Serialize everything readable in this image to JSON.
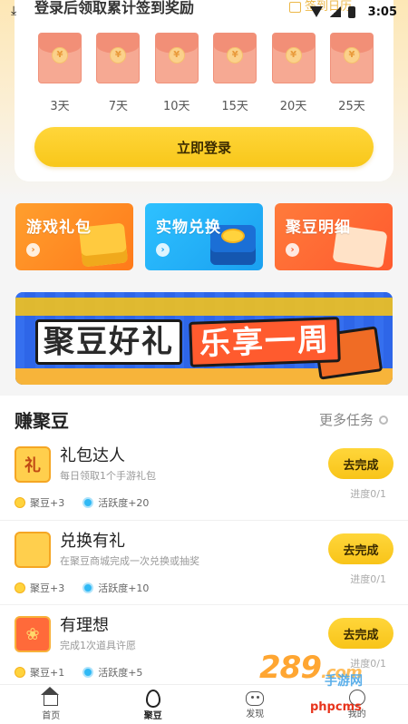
{
  "status_bar": {
    "time": "3:05",
    "download_icon": "download-icon"
  },
  "signin": {
    "title": "登录后领取累计签到奖励",
    "calendar_label": "签到日历",
    "rewards": [
      {
        "day": "3天",
        "icon": "red-envelope-icon"
      },
      {
        "day": "7天",
        "icon": "red-envelope-icon"
      },
      {
        "day": "10天",
        "icon": "red-envelope-icon"
      },
      {
        "day": "15天",
        "icon": "red-envelope-icon"
      },
      {
        "day": "20天",
        "icon": "red-envelope-icon"
      },
      {
        "day": "25天",
        "icon": "red-envelope-icon"
      }
    ],
    "coin_symbol": "¥",
    "login_button": "立即登录"
  },
  "features": [
    {
      "label": "游戏礼包",
      "color": "#ff8a22",
      "arrow": "›"
    },
    {
      "label": "实物兑换",
      "color": "#24b2f8",
      "arrow": "›"
    },
    {
      "label": "聚豆明细",
      "color": "#ff6a34",
      "arrow": "›"
    }
  ],
  "banner": {
    "left_text": "聚豆好礼",
    "right_text": "乐享一周"
  },
  "earn": {
    "title": "赚聚豆",
    "more_label": "更多任务",
    "tasks": [
      {
        "icon_text": "礼",
        "name": "礼包达人",
        "desc": "每日领取1个手游礼包",
        "bean_reward": "聚豆+3",
        "activity_reward": "活跃度+20",
        "button": "去完成",
        "progress": "进度0/1"
      },
      {
        "icon_text": "",
        "name": "兑换有礼",
        "desc": "在聚豆商城完成一次兑换或抽奖",
        "bean_reward": "聚豆+3",
        "activity_reward": "活跃度+10",
        "button": "去完成",
        "progress": "进度0/1"
      },
      {
        "icon_text": "❀",
        "name": "有理想",
        "desc": "完成1次道具许愿",
        "bean_reward": "聚豆+1",
        "activity_reward": "活跃度+5",
        "button": "去完成",
        "progress": "进度0/1"
      }
    ]
  },
  "bottom_nav": [
    {
      "label": "首页",
      "icon": "home-icon",
      "active": false
    },
    {
      "label": "聚豆",
      "icon": "bean-icon",
      "active": true
    },
    {
      "label": "发现",
      "icon": "discover-icon",
      "active": false
    },
    {
      "label": "我的",
      "icon": "profile-icon",
      "active": false
    }
  ],
  "watermark": {
    "logo_num": "289",
    "logo_com": ".com",
    "logo_sub": "手游网",
    "php": "phpcms"
  },
  "colors": {
    "accent_yellow": "#f8c71a",
    "envelope": "#f6a993",
    "banner_blue": "#2e66e8"
  }
}
